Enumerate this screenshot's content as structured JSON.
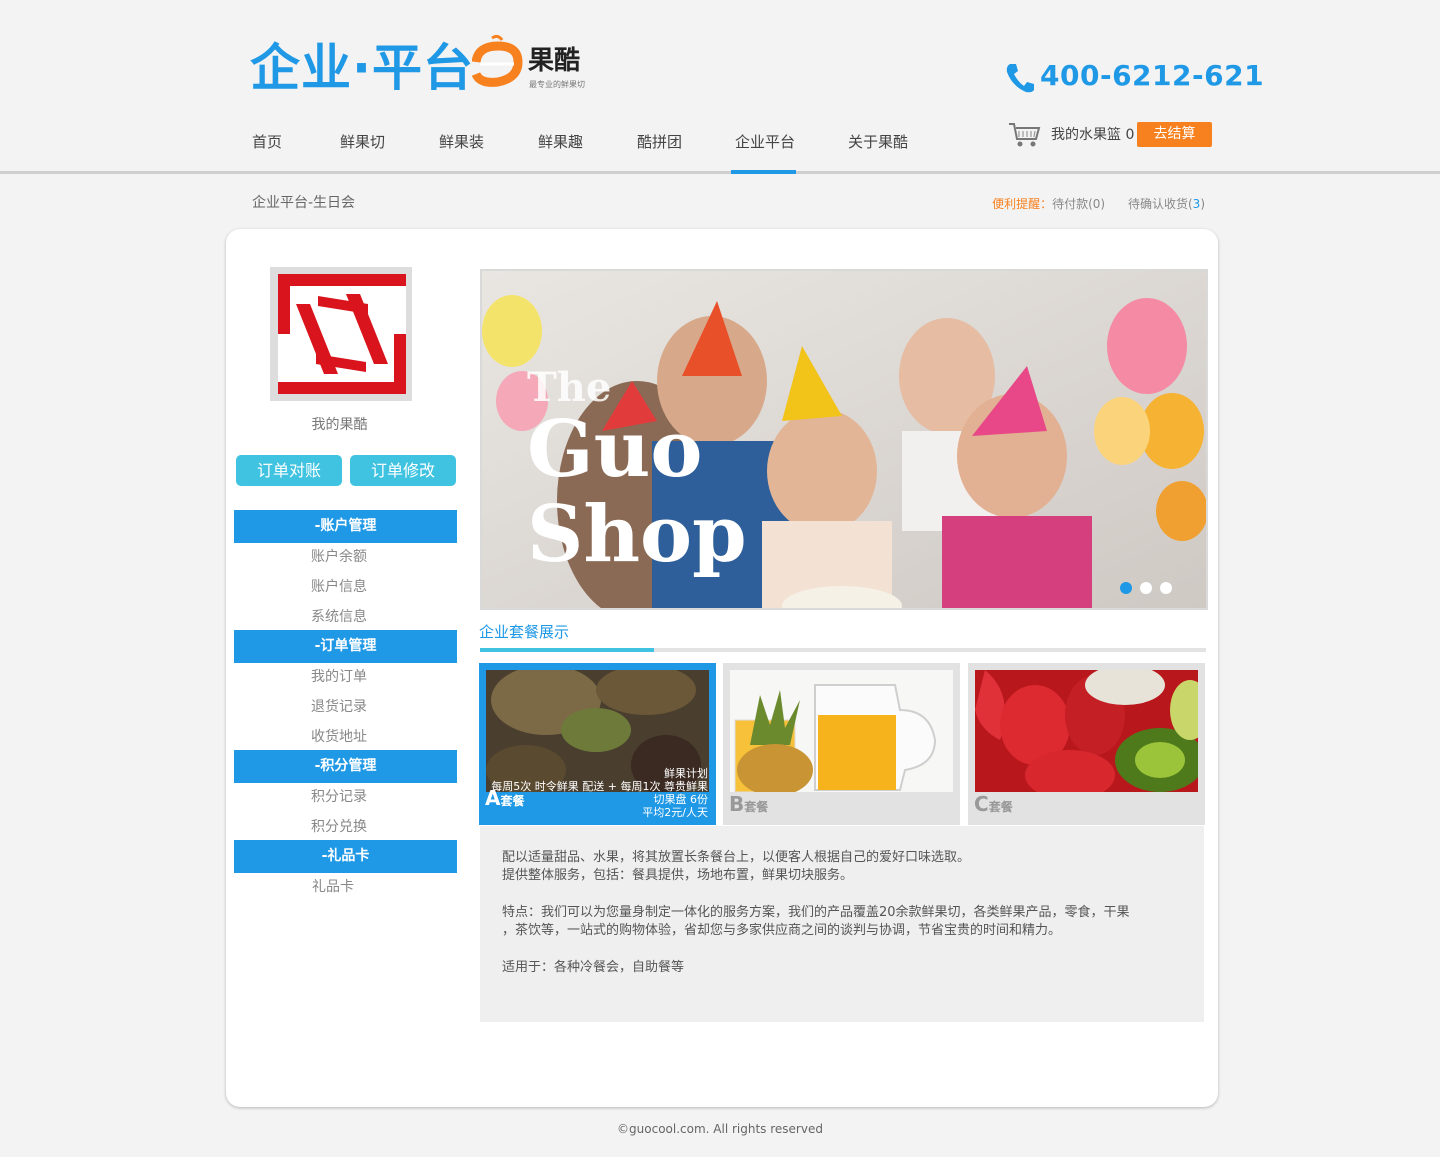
{
  "header": {
    "brand_part1": "企业",
    "brand_dot": "·",
    "brand_part2": "平台",
    "logo_name": "果酷",
    "logo_slogan": "最专业的鲜果切",
    "phone": "400-6212-621"
  },
  "nav": {
    "items": [
      "首页",
      "鲜果切",
      "鲜果装",
      "鲜果趣",
      "酷拼团",
      "企业平台",
      "关于果酷"
    ],
    "active": "企业平台"
  },
  "cart": {
    "label": "我的水果篮 0",
    "checkout": "去结算"
  },
  "breadcrumb": "企业平台-生日会",
  "reminder": {
    "label": "便利提醒：",
    "pending_pay_text": "待付款(",
    "pending_pay_count": "0",
    "pending_pay_close": ")",
    "pending_receive_text": "待确认收货(",
    "pending_receive_count": "3",
    "pending_receive_close": ")"
  },
  "sidebar": {
    "my_label": "我的果酷",
    "btn_reconcile": "订单对账",
    "btn_modify": "订单修改",
    "groups": [
      {
        "title": "-账户管理",
        "links": [
          "账户余额",
          "账户信息",
          "系统信息"
        ]
      },
      {
        "title": "-订单管理",
        "links": [
          "我的订单",
          "退货记录",
          "收货地址"
        ]
      },
      {
        "title": "-积分管理",
        "links": [
          "积分记录",
          "积分兑换"
        ]
      },
      {
        "title": "-礼品卡",
        "links": [
          "礼品卡"
        ]
      }
    ]
  },
  "banner": {
    "text_the": "The",
    "text_guo": "Guo",
    "text_shop": "Shop",
    "slide_count": 3,
    "active_slide": 1,
    "colors": {
      "active_dot": "#1f98e6",
      "inactive_dot": "#ffffff"
    }
  },
  "packages": {
    "section_title": "企业套餐展示",
    "items": [
      {
        "letter": "A",
        "suffix": "套餐",
        "overlay": [
          "鲜果计划",
          "每周5次 时令鲜果 配送 + 每周1次 尊贵鲜果",
          "切果盘 6份",
          "平均2元/人天"
        ]
      },
      {
        "letter": "B",
        "suffix": "套餐"
      },
      {
        "letter": "C",
        "suffix": "套餐"
      }
    ],
    "description": [
      "配以适量甜品、水果，将其放置长条餐台上，以便客人根据自己的爱好口味选取。",
      "提供整体服务，包括：餐具提供，场地布置，鲜果切块服务。",
      "特点：我们可以为您量身制定一体化的服务方案，我们的产品覆盖20余款鲜果切，各类鲜果产品，零食，干果",
      "，茶饮等，一站式的购物体验，省却您与多家供应商之间的谈判与协调，节省宝贵的时间和精力。",
      "适用于：各种冷餐会，自助餐等"
    ]
  },
  "footer": "©guocool.com. All rights reserved",
  "colors": {
    "brand_blue": "#1f98e6",
    "accent_orange": "#f7801f",
    "cyan": "#3fc3e0"
  }
}
